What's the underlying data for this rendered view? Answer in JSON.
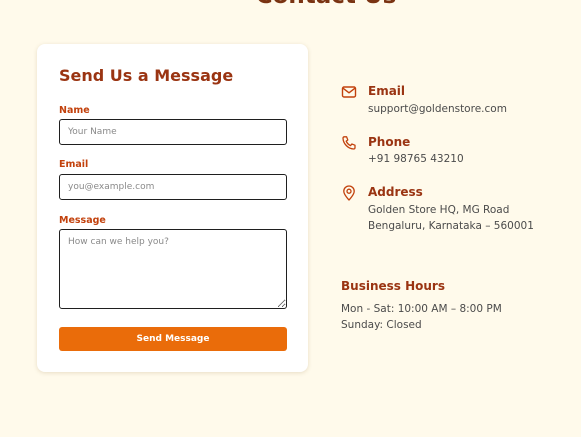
{
  "page": {
    "title": "Contact Us"
  },
  "form": {
    "heading": "Send Us a Message",
    "name": {
      "label": "Name",
      "placeholder": "Your Name",
      "value": ""
    },
    "email": {
      "label": "Email",
      "placeholder": "you@example.com",
      "value": ""
    },
    "message": {
      "label": "Message",
      "placeholder": "How can we help you?",
      "value": ""
    },
    "submit_label": "Send Message"
  },
  "contact": {
    "email": {
      "title": "Email",
      "value": "support@goldenstore.com",
      "icon": "mail-icon"
    },
    "phone": {
      "title": "Phone",
      "value": "+91 98765 43210",
      "icon": "phone-icon"
    },
    "address": {
      "title": "Address",
      "line1": "Golden Store HQ, MG Road",
      "line2": "Bengaluru, Karnataka – 560001",
      "icon": "map-pin-icon"
    }
  },
  "hours": {
    "title": "Business Hours",
    "weekdays": "Mon - Sat: 10:00 AM – 8:00 PM",
    "sunday": "Sunday: Closed"
  },
  "colors": {
    "background": "#fffaeb",
    "accent": "#ea6c0a",
    "heading": "#9a3412",
    "label": "#c2410c"
  }
}
